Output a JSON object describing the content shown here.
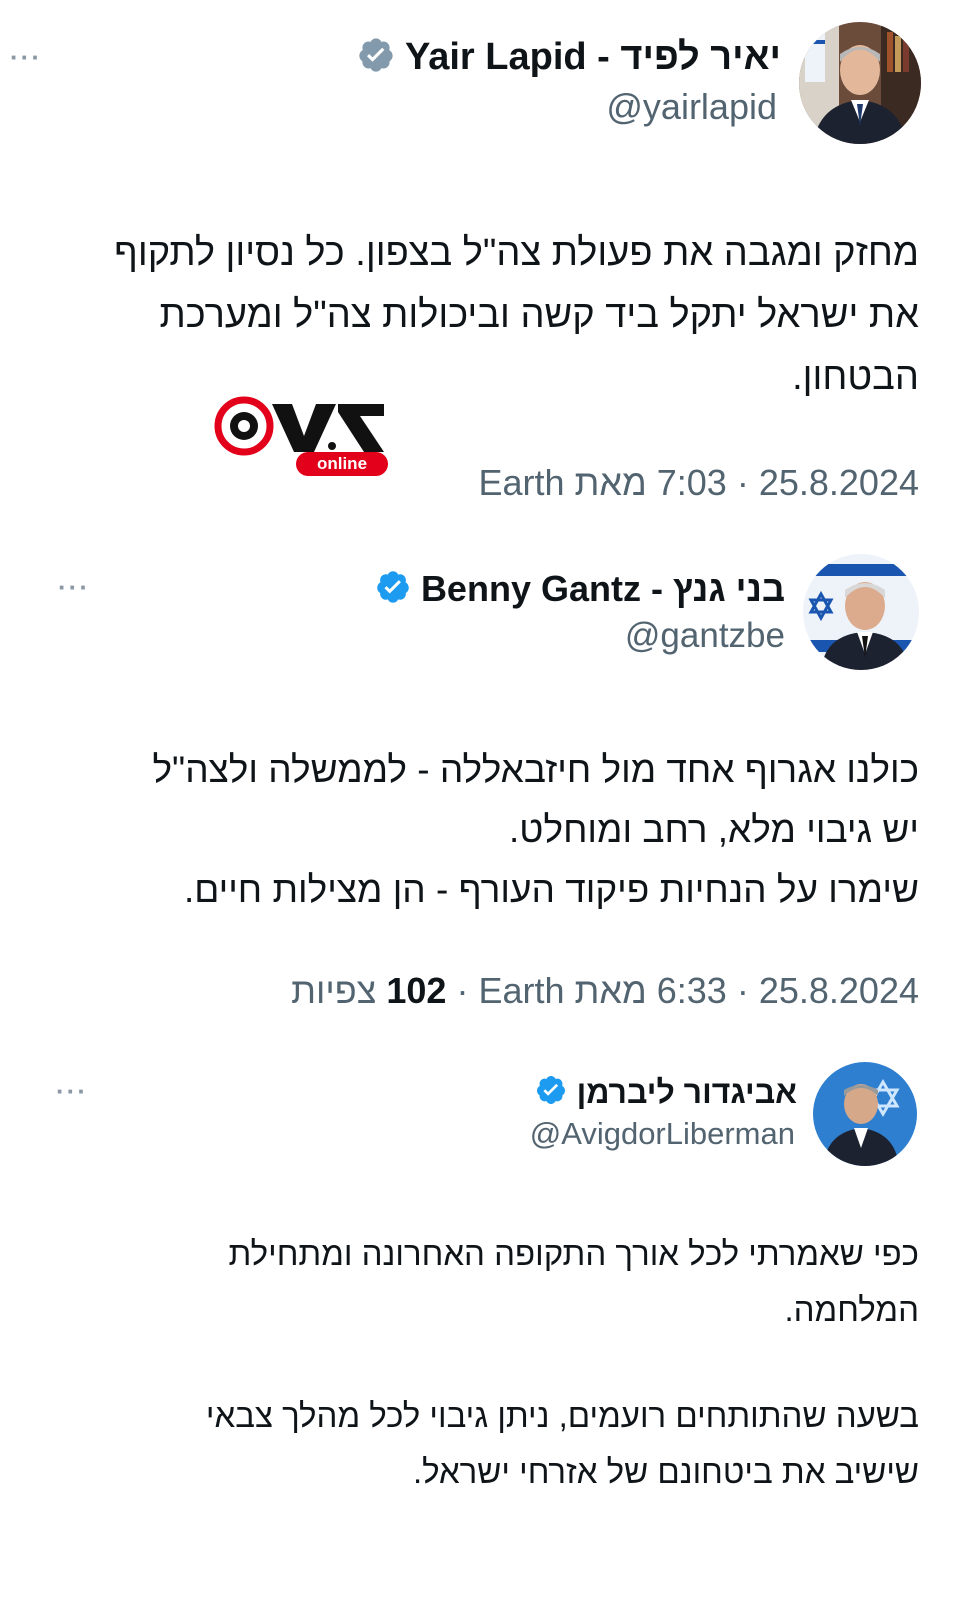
{
  "tweets": [
    {
      "display_name": "Yair Lapid - יאיר לפיד",
      "handle": "@yairlapid",
      "verified_badge": "gray-check-badge",
      "more_label": "···",
      "body": "מחזק ומגבה את פעולת צה\"ל בצפון. כל נסיון לתקוף\nאת ישראל יתקל ביד קשה וביכולות צה\"ל ומערכת\nהבטחון.",
      "date": "25.8.2024",
      "time": "7:03",
      "time_suffix": "מאת Earth"
    },
    {
      "display_name": "Benny Gantz - בני גנץ",
      "handle": "@gantzbe",
      "verified_badge": "blue-check-badge",
      "more_label": "···",
      "body": "כולנו אגרוף אחד מול חיזבאללה - לממשלה ולצה\"ל\nיש גיבוי מלא, רחב ומוחלט.\nשימרו על הנחיות פיקוד העורף - הן מצילות חיים.",
      "date": "25.8.2024",
      "time": "6:33",
      "time_suffix": "מאת Earth",
      "views_count": "102",
      "views_label": "צפיות"
    },
    {
      "display_name": "אביגדור ליברמן",
      "handle": "@AvigdorLiberman",
      "verified_badge": "blue-check-badge",
      "more_label": "···",
      "body_p1": "כפי שאמרתי לכל אורך התקופה האחרונה ומתחילת\nהמלחמה.",
      "body_p2": "בשעה שהתותחים רועמים, ניתן גיבוי לכל מהלך צבאי\nשישיב את ביטחונם של אזרחי ישראל."
    }
  ],
  "watermark": {
    "brand_text": "online"
  },
  "colors": {
    "verified_blue": "#1d9bf0",
    "verified_gray": "#829aab",
    "secondary_text": "#536471",
    "watermark_red": "#e2001a"
  }
}
